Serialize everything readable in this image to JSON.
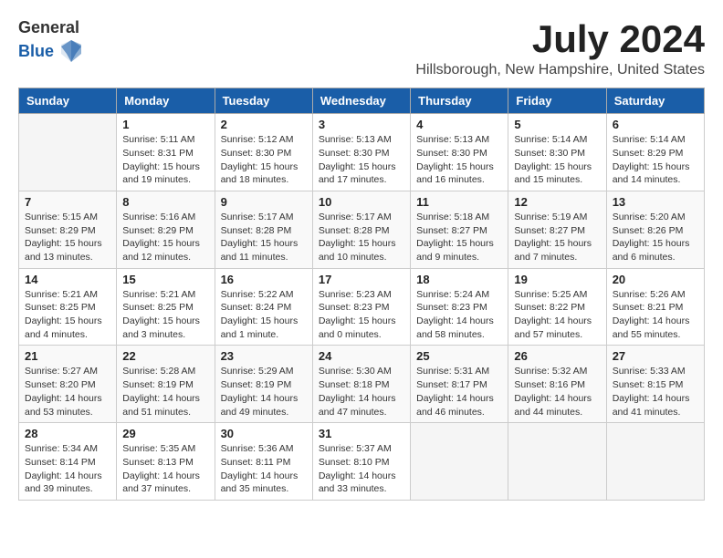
{
  "logo": {
    "general": "General",
    "blue": "Blue"
  },
  "title": {
    "month": "July 2024",
    "location": "Hillsborough, New Hampshire, United States"
  },
  "headers": [
    "Sunday",
    "Monday",
    "Tuesday",
    "Wednesday",
    "Thursday",
    "Friday",
    "Saturday"
  ],
  "weeks": [
    [
      {
        "day": "",
        "info": ""
      },
      {
        "day": "1",
        "info": "Sunrise: 5:11 AM\nSunset: 8:31 PM\nDaylight: 15 hours\nand 19 minutes."
      },
      {
        "day": "2",
        "info": "Sunrise: 5:12 AM\nSunset: 8:30 PM\nDaylight: 15 hours\nand 18 minutes."
      },
      {
        "day": "3",
        "info": "Sunrise: 5:13 AM\nSunset: 8:30 PM\nDaylight: 15 hours\nand 17 minutes."
      },
      {
        "day": "4",
        "info": "Sunrise: 5:13 AM\nSunset: 8:30 PM\nDaylight: 15 hours\nand 16 minutes."
      },
      {
        "day": "5",
        "info": "Sunrise: 5:14 AM\nSunset: 8:30 PM\nDaylight: 15 hours\nand 15 minutes."
      },
      {
        "day": "6",
        "info": "Sunrise: 5:14 AM\nSunset: 8:29 PM\nDaylight: 15 hours\nand 14 minutes."
      }
    ],
    [
      {
        "day": "7",
        "info": "Sunrise: 5:15 AM\nSunset: 8:29 PM\nDaylight: 15 hours\nand 13 minutes."
      },
      {
        "day": "8",
        "info": "Sunrise: 5:16 AM\nSunset: 8:29 PM\nDaylight: 15 hours\nand 12 minutes."
      },
      {
        "day": "9",
        "info": "Sunrise: 5:17 AM\nSunset: 8:28 PM\nDaylight: 15 hours\nand 11 minutes."
      },
      {
        "day": "10",
        "info": "Sunrise: 5:17 AM\nSunset: 8:28 PM\nDaylight: 15 hours\nand 10 minutes."
      },
      {
        "day": "11",
        "info": "Sunrise: 5:18 AM\nSunset: 8:27 PM\nDaylight: 15 hours\nand 9 minutes."
      },
      {
        "day": "12",
        "info": "Sunrise: 5:19 AM\nSunset: 8:27 PM\nDaylight: 15 hours\nand 7 minutes."
      },
      {
        "day": "13",
        "info": "Sunrise: 5:20 AM\nSunset: 8:26 PM\nDaylight: 15 hours\nand 6 minutes."
      }
    ],
    [
      {
        "day": "14",
        "info": "Sunrise: 5:21 AM\nSunset: 8:25 PM\nDaylight: 15 hours\nand 4 minutes."
      },
      {
        "day": "15",
        "info": "Sunrise: 5:21 AM\nSunset: 8:25 PM\nDaylight: 15 hours\nand 3 minutes."
      },
      {
        "day": "16",
        "info": "Sunrise: 5:22 AM\nSunset: 8:24 PM\nDaylight: 15 hours\nand 1 minute."
      },
      {
        "day": "17",
        "info": "Sunrise: 5:23 AM\nSunset: 8:23 PM\nDaylight: 15 hours\nand 0 minutes."
      },
      {
        "day": "18",
        "info": "Sunrise: 5:24 AM\nSunset: 8:23 PM\nDaylight: 14 hours\nand 58 minutes."
      },
      {
        "day": "19",
        "info": "Sunrise: 5:25 AM\nSunset: 8:22 PM\nDaylight: 14 hours\nand 57 minutes."
      },
      {
        "day": "20",
        "info": "Sunrise: 5:26 AM\nSunset: 8:21 PM\nDaylight: 14 hours\nand 55 minutes."
      }
    ],
    [
      {
        "day": "21",
        "info": "Sunrise: 5:27 AM\nSunset: 8:20 PM\nDaylight: 14 hours\nand 53 minutes."
      },
      {
        "day": "22",
        "info": "Sunrise: 5:28 AM\nSunset: 8:19 PM\nDaylight: 14 hours\nand 51 minutes."
      },
      {
        "day": "23",
        "info": "Sunrise: 5:29 AM\nSunset: 8:19 PM\nDaylight: 14 hours\nand 49 minutes."
      },
      {
        "day": "24",
        "info": "Sunrise: 5:30 AM\nSunset: 8:18 PM\nDaylight: 14 hours\nand 47 minutes."
      },
      {
        "day": "25",
        "info": "Sunrise: 5:31 AM\nSunset: 8:17 PM\nDaylight: 14 hours\nand 46 minutes."
      },
      {
        "day": "26",
        "info": "Sunrise: 5:32 AM\nSunset: 8:16 PM\nDaylight: 14 hours\nand 44 minutes."
      },
      {
        "day": "27",
        "info": "Sunrise: 5:33 AM\nSunset: 8:15 PM\nDaylight: 14 hours\nand 41 minutes."
      }
    ],
    [
      {
        "day": "28",
        "info": "Sunrise: 5:34 AM\nSunset: 8:14 PM\nDaylight: 14 hours\nand 39 minutes."
      },
      {
        "day": "29",
        "info": "Sunrise: 5:35 AM\nSunset: 8:13 PM\nDaylight: 14 hours\nand 37 minutes."
      },
      {
        "day": "30",
        "info": "Sunrise: 5:36 AM\nSunset: 8:11 PM\nDaylight: 14 hours\nand 35 minutes."
      },
      {
        "day": "31",
        "info": "Sunrise: 5:37 AM\nSunset: 8:10 PM\nDaylight: 14 hours\nand 33 minutes."
      },
      {
        "day": "",
        "info": ""
      },
      {
        "day": "",
        "info": ""
      },
      {
        "day": "",
        "info": ""
      }
    ]
  ]
}
